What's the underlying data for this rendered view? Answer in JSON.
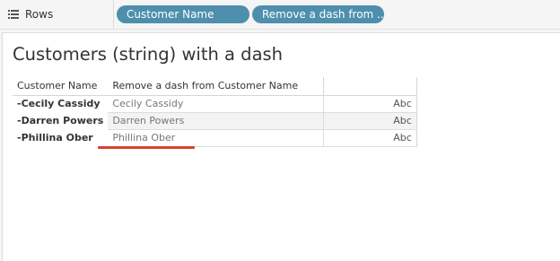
{
  "shelf": {
    "label": "Rows",
    "icon": "rows-list-icon",
    "pills": [
      "Customer Name",
      "Remove a dash from .."
    ],
    "pill_color": "#4e8fad"
  },
  "sheet": {
    "title": "Customers (string) with a dash",
    "columns": [
      "Customer Name",
      "Remove a dash from Customer Name",
      ""
    ],
    "rows": [
      {
        "customer": "-Cecily Cassidy",
        "removed": "Cecily Cassidy",
        "value": "Abc"
      },
      {
        "customer": "-Darren Powers",
        "removed": "Darren Powers",
        "value": "Abc"
      },
      {
        "customer": "-Phillina Ober",
        "removed": "Phillina Ober",
        "value": "Abc"
      }
    ],
    "annotation_color": "#d9412f"
  }
}
